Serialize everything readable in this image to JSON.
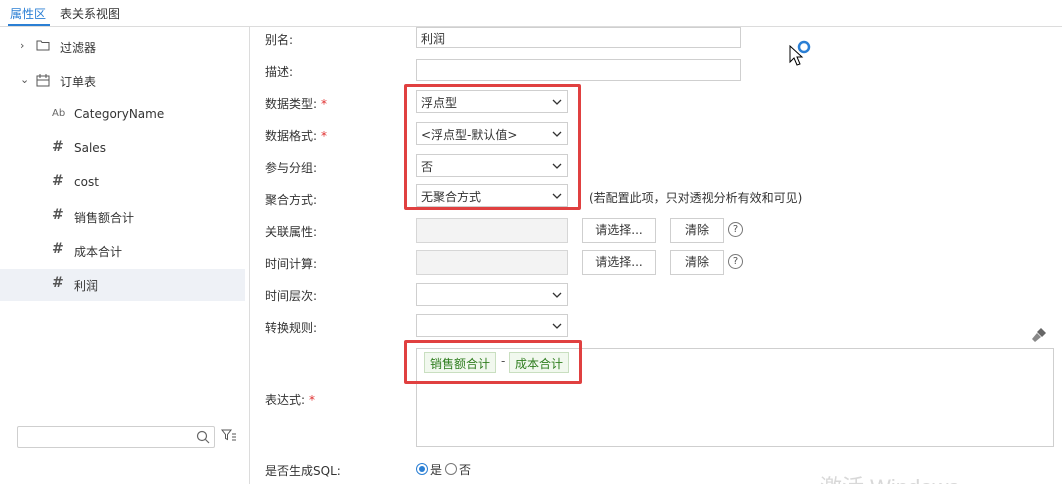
{
  "tabs": [
    "属性区",
    "表关系视图"
  ],
  "tree": {
    "filter": "过滤器",
    "table": "订单表",
    "fields": [
      {
        "label": "CategoryName",
        "icon": "text-field-icon"
      },
      {
        "label": "Sales",
        "icon": "number-field-icon"
      },
      {
        "label": "cost",
        "icon": "number-field-icon"
      },
      {
        "label": "销售额合计",
        "icon": "number-field-icon"
      },
      {
        "label": "成本合计",
        "icon": "number-field-icon"
      },
      {
        "label": "利润",
        "icon": "number-field-icon"
      }
    ],
    "field_glyphs": {
      "text": "Ab",
      "number": "#"
    }
  },
  "form": {
    "alias_label": "别名:",
    "alias_value": "利润",
    "desc_label": "描述:",
    "data_type_label": "数据类型:",
    "data_type_value": "浮点型",
    "data_format_label": "数据格式:",
    "data_format_value": "<浮点型-默认值>",
    "grouping_label": "参与分组:",
    "grouping_value": "否",
    "agg_label": "聚合方式:",
    "agg_value": "无聚合方式",
    "agg_note": "(若配置此项，只对透视分析有效和可见)",
    "related_label": "关联属性:",
    "time_calc_label": "时间计算:",
    "time_level_label": "时间层次:",
    "convert_label": "转换规则:",
    "expr_label": "表达式:",
    "sql_label": "是否生成SQL:",
    "select_btn": "请选择...",
    "clear_btn": "清除",
    "help": "?",
    "required_mark": "*",
    "expr_tokens": [
      "销售额合计",
      "-",
      "成本合计"
    ],
    "yes": "是",
    "no": "否"
  },
  "watermark": "激活 Windows",
  "colors": {
    "accent": "#2b7fd4",
    "highlight": "#e04040",
    "chip": "#2e7d1e"
  }
}
